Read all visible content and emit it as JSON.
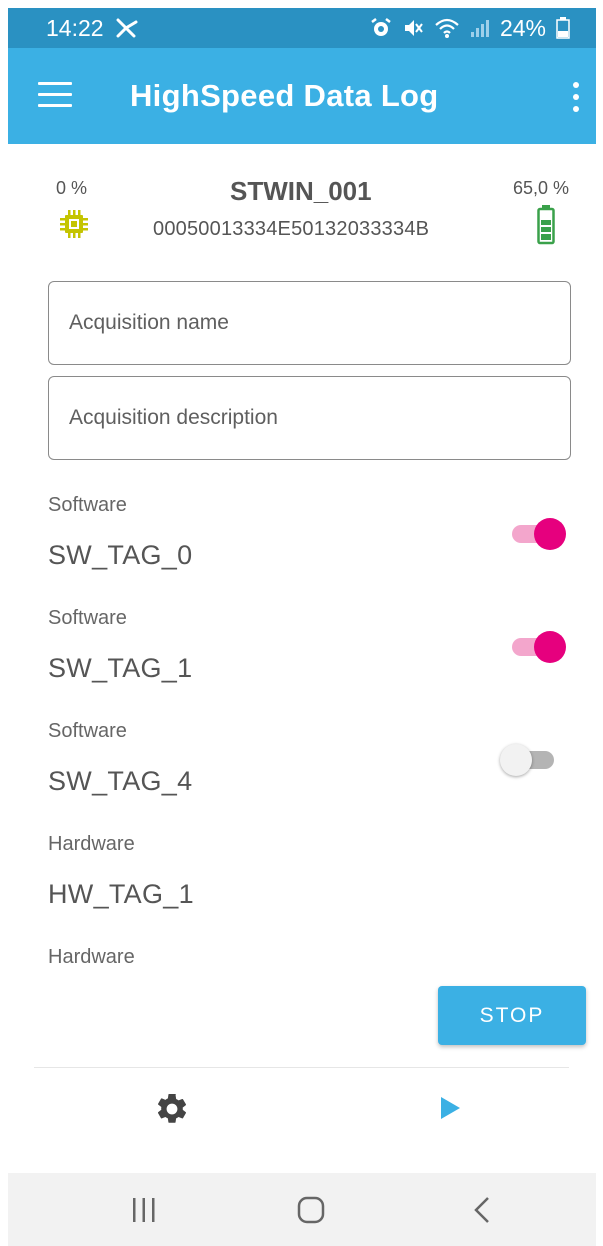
{
  "status_bar": {
    "time": "14:22",
    "battery_text": "24%",
    "icons": [
      "cast-icon",
      "alarm-icon",
      "mute-icon",
      "wifi-icon",
      "signal-icon",
      "battery-icon"
    ]
  },
  "app_bar": {
    "title": "HighSpeed Data Log",
    "menu_icon": "hamburger-menu-icon",
    "more_icon": "more-vert-icon"
  },
  "device": {
    "cpu_label": "0 %",
    "name": "STWIN_001",
    "id": "00050013334E50132033334B",
    "battery_label": "65,0 %"
  },
  "form": {
    "name_placeholder": "Acquisition name",
    "description_placeholder": "Acquisition description"
  },
  "tags": [
    {
      "type": "Software",
      "name": "SW_TAG_0",
      "enabled": true
    },
    {
      "type": "Software",
      "name": "SW_TAG_1",
      "enabled": true
    },
    {
      "type": "Software",
      "name": "SW_TAG_4",
      "enabled": false
    },
    {
      "type": "Hardware",
      "name": "HW_TAG_1",
      "enabled": null
    },
    {
      "type": "Hardware",
      "name": "",
      "enabled": null
    }
  ],
  "actions": {
    "stop_label": "STOP"
  },
  "bottom_nav": {
    "icons": [
      "gear-icon",
      "play-icon"
    ]
  },
  "system_nav": {
    "icons": [
      "recent-apps-icon",
      "home-icon",
      "back-icon"
    ]
  },
  "colors": {
    "primary": "#3bb0e4",
    "status_bar": "#2a91c2",
    "accent": "#e6007e",
    "cpu": "#c4c400",
    "battery": "#3aa14a"
  }
}
